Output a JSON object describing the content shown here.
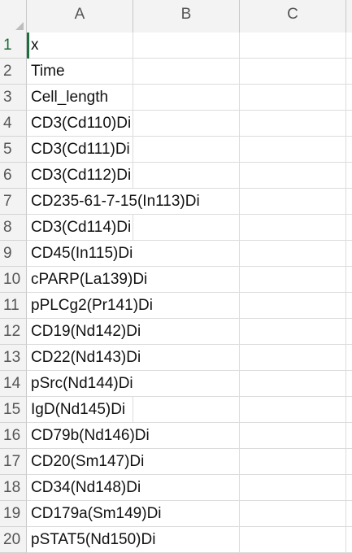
{
  "columns": [
    "A",
    "B",
    "C"
  ],
  "rows": [
    {
      "num": "1",
      "a": "x"
    },
    {
      "num": "2",
      "a": "Time"
    },
    {
      "num": "3",
      "a": "Cell_length"
    },
    {
      "num": "4",
      "a": "CD3(Cd110)Di"
    },
    {
      "num": "5",
      "a": "CD3(Cd111)Di"
    },
    {
      "num": "6",
      "a": "CD3(Cd112)Di"
    },
    {
      "num": "7",
      "a": "CD235-61-7-15(In113)Di"
    },
    {
      "num": "8",
      "a": "CD3(Cd114)Di"
    },
    {
      "num": "9",
      "a": "CD45(In115)Di"
    },
    {
      "num": "10",
      "a": "cPARP(La139)Di"
    },
    {
      "num": "11",
      "a": "pPLCg2(Pr141)Di"
    },
    {
      "num": "12",
      "a": "CD19(Nd142)Di"
    },
    {
      "num": "13",
      "a": "CD22(Nd143)Di"
    },
    {
      "num": "14",
      "a": "pSrc(Nd144)Di"
    },
    {
      "num": "15",
      "a": "IgD(Nd145)Di"
    },
    {
      "num": "16",
      "a": "CD79b(Nd146)Di"
    },
    {
      "num": "17",
      "a": "CD20(Sm147)Di"
    },
    {
      "num": "18",
      "a": "CD34(Nd148)Di"
    },
    {
      "num": "19",
      "a": "CD179a(Sm149)Di"
    },
    {
      "num": "20",
      "a": "pSTAT5(Nd150)Di"
    }
  ],
  "active_cell": "A1",
  "colors": {
    "header_bg": "#f3f3f3",
    "active_accent": "#1f6e3f",
    "gridline": "#dcdcdc"
  }
}
